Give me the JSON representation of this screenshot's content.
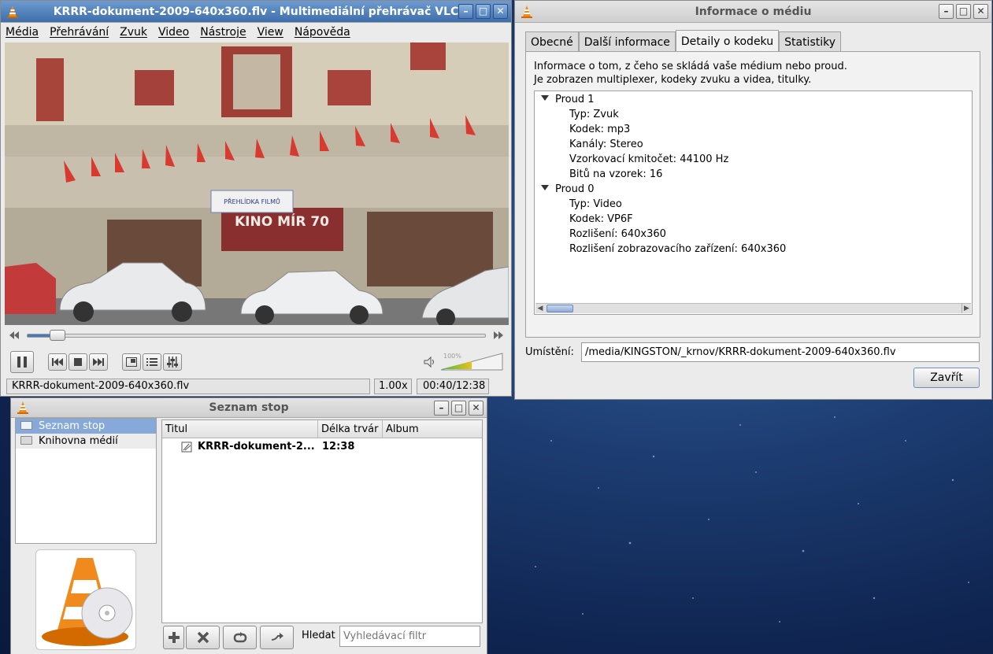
{
  "vlc": {
    "title": "KRRR-dokument-2009-640x360.flv - Multimediální přehrávač VLC",
    "menu": [
      "Média",
      "Přehrávání",
      "Zvuk",
      "Video",
      "Nástroje",
      "View",
      "Nápověda"
    ],
    "video_overlay": {
      "banner": "PŘEHLÍDKA FILMŮ",
      "sign": "KINO MÍR 70"
    },
    "seek_progress": 0.053,
    "volume": "100%",
    "volume_level": 1.0,
    "status": {
      "filename": "KRRR-dokument-2009-640x360.flv",
      "speed": "1.00x",
      "time": "00:40/12:38"
    }
  },
  "info": {
    "title": "Informace o médiu",
    "tabs": [
      "Obecné",
      "Další informace",
      "Detaily o kodeku",
      "Statistiky"
    ],
    "selected_tab": 2,
    "description_line1": "Informace o tom, z čeho se skládá vaše médium nebo proud.",
    "description_line2": "Je zobrazen multiplexer, kodeky zvuku a videa, titulky.",
    "streams": [
      {
        "label": "Proud 1",
        "props": [
          "Typ: Zvuk",
          "Kodek: mp3",
          "Kanály: Stereo",
          "Vzorkovací kmitočet: 44100 Hz",
          "Bitů na vzorek: 16"
        ]
      },
      {
        "label": "Proud 0",
        "props": [
          "Typ: Video",
          "Kodek: VP6F",
          "Rozlišení: 640x360",
          "Rozlišení zobrazovacího zařízení: 640x360"
        ]
      }
    ],
    "location_label": "Umístění:",
    "location_value": "/media/KINGSTON/_krnov/KRRR-dokument-2009-640x360.flv",
    "close_button": "Zavřít"
  },
  "playlist": {
    "title": "Seznam stop",
    "sidebar": [
      "Seznam stop",
      "Knihovna médií"
    ],
    "columns": [
      "Titul",
      "Délka trvár",
      "Album"
    ],
    "rows": [
      {
        "title": "KRRR-dokument-2...",
        "duration": "12:38",
        "album": ""
      }
    ],
    "search_label": "Hledat",
    "search_placeholder": "Vyhledávací filtr"
  },
  "colors": {
    "active_title": "#4a7abb",
    "selection": "#86a9d9",
    "vlc_orange": "#f08a1c"
  }
}
